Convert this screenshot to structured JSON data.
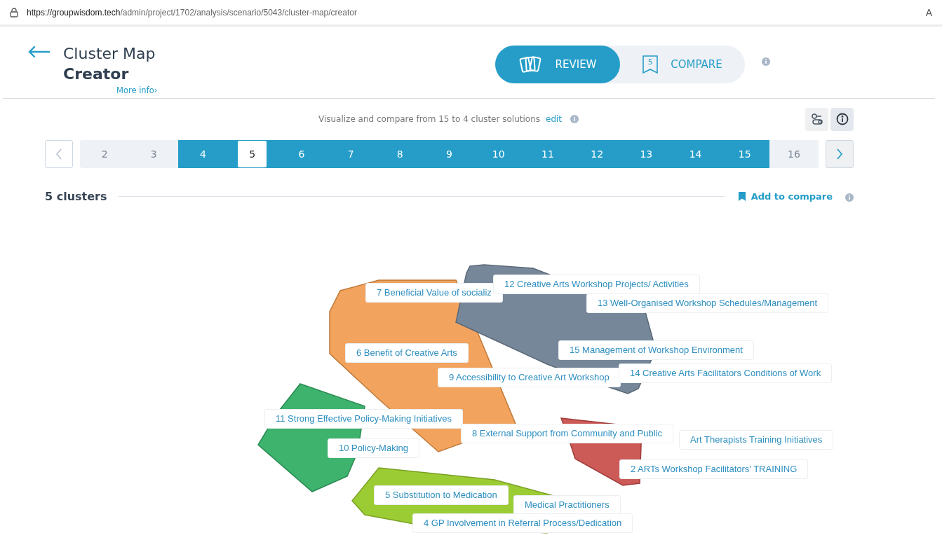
{
  "url_bar": {
    "url_host": "https://groupwisdom.tech",
    "url_path": "/admin/project/1702/analysis/scenario/5043/cluster-map/creator",
    "reader_icon": "A"
  },
  "header": {
    "title": "Cluster Map",
    "subtitle": "Creator",
    "more_info": "More info›"
  },
  "modes": [
    {
      "kind": "cards",
      "label": "REVIEW",
      "selected": true
    },
    {
      "kind": "bookmark",
      "label": "COMPARE",
      "badge": "5",
      "selected": false
    }
  ],
  "range_note": {
    "text": "Visualize and compare from 15 to 4 cluster solutions",
    "edit": "edit"
  },
  "pagination": [
    {
      "label": "2",
      "in_range": false,
      "selected": false
    },
    {
      "label": "3",
      "in_range": false,
      "selected": false
    },
    {
      "label": "4",
      "in_range": true,
      "selected": false
    },
    {
      "label": "5",
      "in_range": true,
      "selected": true
    },
    {
      "label": "6",
      "in_range": true,
      "selected": false
    },
    {
      "label": "7",
      "in_range": true,
      "selected": false
    },
    {
      "label": "8",
      "in_range": true,
      "selected": false
    },
    {
      "label": "9",
      "in_range": true,
      "selected": false
    },
    {
      "label": "10",
      "in_range": true,
      "selected": false
    },
    {
      "label": "11",
      "in_range": true,
      "selected": false
    },
    {
      "label": "12",
      "in_range": true,
      "selected": false
    },
    {
      "label": "13",
      "in_range": true,
      "selected": false
    },
    {
      "label": "14",
      "in_range": true,
      "selected": false
    },
    {
      "label": "15",
      "in_range": true,
      "selected": false
    },
    {
      "label": "16",
      "in_range": false,
      "selected": false
    }
  ],
  "section": {
    "title": "5 clusters",
    "add_to_compare": "Add to compare"
  },
  "clusters": [
    {
      "color": "#f2a35e"
    },
    {
      "color": "#76879a"
    },
    {
      "color": "#3db36e"
    },
    {
      "color": "#cc5a57"
    },
    {
      "color": "#9ccc33"
    }
  ],
  "labels": [
    {
      "text": "12 Creative Arts Workshop Projects/ Activities"
    },
    {
      "text": "7 Beneficial Value of socializ"
    },
    {
      "text": "13 Well-Organised Workshop Schedules/Management"
    },
    {
      "text": "6 Benefit of Creative Arts"
    },
    {
      "text": "15 Management of Workshop Environment"
    },
    {
      "text": "14 Creative Arts Facilitators Conditions of Work"
    },
    {
      "text": "9 Accessibility to Creative Art Workshop"
    },
    {
      "text": "11 Strong Effective Policy-Making Initiatives"
    },
    {
      "text": "8 External Support from Community and Public"
    },
    {
      "text": "Art Therapists Training Initiatives"
    },
    {
      "text": "10 Policy-Making"
    },
    {
      "text": "2 ARTs Workshop Facilitators' TRAINING"
    },
    {
      "text": "5 Substitution to Medication"
    },
    {
      "text": "Medical Practitioners"
    },
    {
      "text": "4 GP Involvement in Referral Process/Dedication"
    }
  ]
}
